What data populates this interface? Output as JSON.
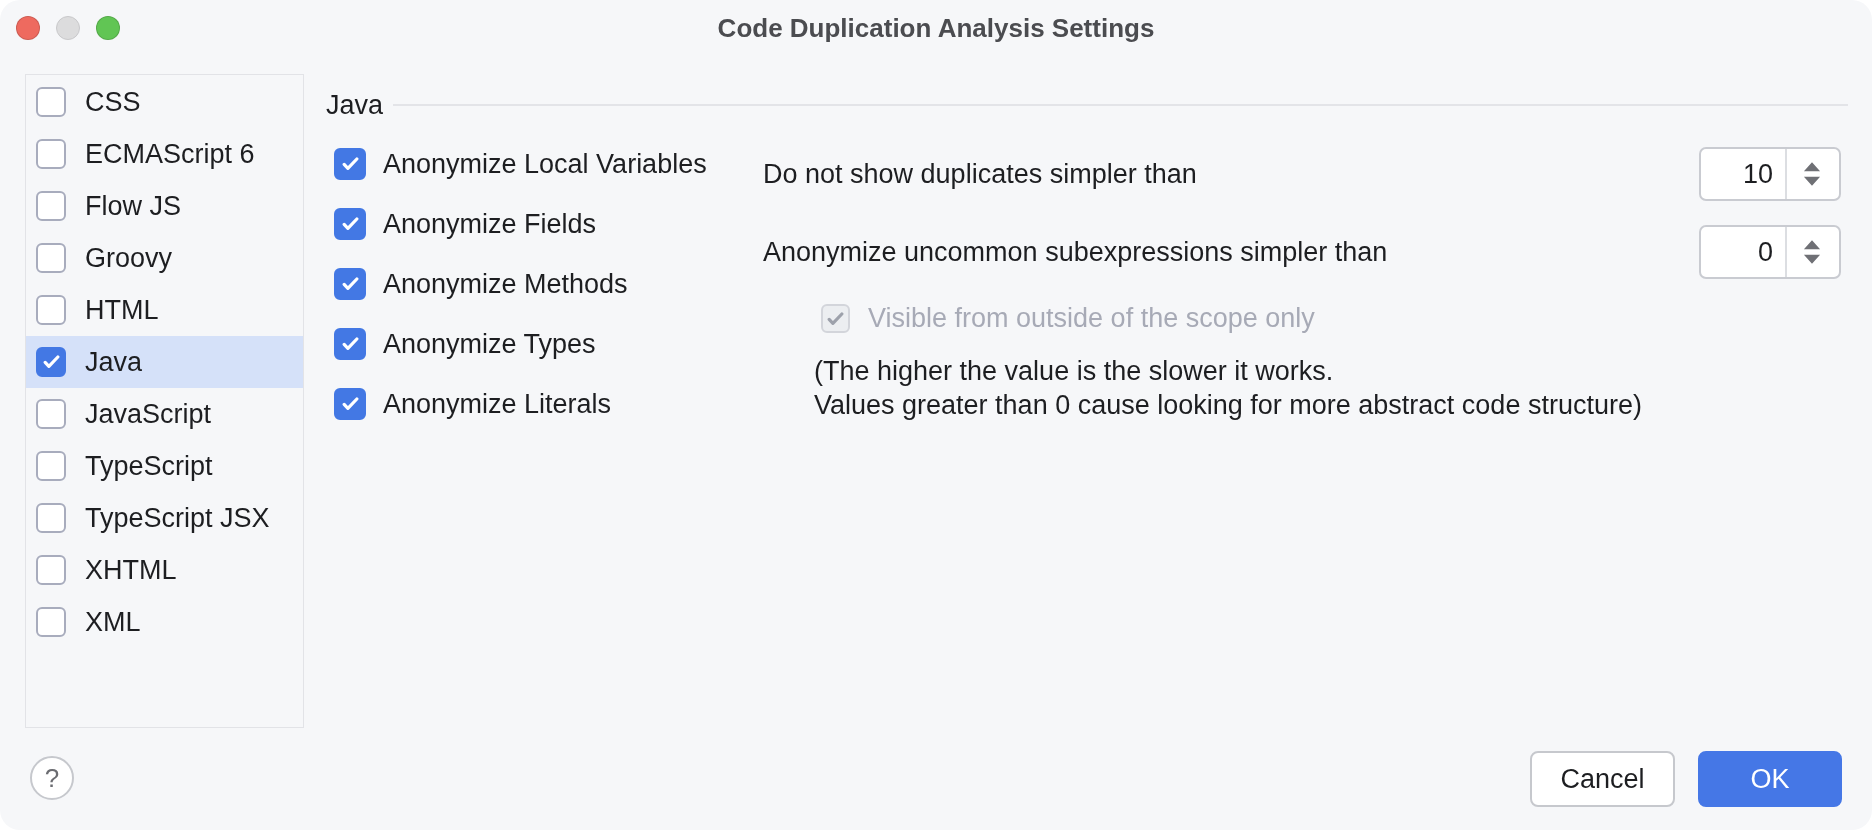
{
  "window": {
    "title": "Code Duplication Analysis Settings",
    "controls": [
      {
        "kind": "close",
        "disabled": false
      },
      {
        "kind": "minimize",
        "disabled": true
      },
      {
        "kind": "zoom",
        "disabled": false
      }
    ]
  },
  "languages": [
    {
      "label": "CSS",
      "checked": false,
      "selected": false
    },
    {
      "label": "ECMAScript 6",
      "checked": false,
      "selected": false
    },
    {
      "label": "Flow JS",
      "checked": false,
      "selected": false
    },
    {
      "label": "Groovy",
      "checked": false,
      "selected": false
    },
    {
      "label": "HTML",
      "checked": false,
      "selected": false
    },
    {
      "label": "Java",
      "checked": true,
      "selected": true
    },
    {
      "label": "JavaScript",
      "checked": false,
      "selected": false
    },
    {
      "label": "TypeScript",
      "checked": false,
      "selected": false
    },
    {
      "label": "TypeScript JSX",
      "checked": false,
      "selected": false
    },
    {
      "label": "XHTML",
      "checked": false,
      "selected": false
    },
    {
      "label": "XML",
      "checked": false,
      "selected": false
    }
  ],
  "section": {
    "title": "Java",
    "options": [
      {
        "label": "Anonymize Local Variables",
        "checked": true
      },
      {
        "label": "Anonymize Fields",
        "checked": true
      },
      {
        "label": "Anonymize Methods",
        "checked": true
      },
      {
        "label": "Anonymize Types",
        "checked": true
      },
      {
        "label": "Anonymize Literals",
        "checked": true
      }
    ]
  },
  "settings": [
    {
      "label": "Do not show duplicates simpler than",
      "value": "10"
    },
    {
      "label": "Anonymize uncommon subexpressions simpler than",
      "value": "0"
    }
  ],
  "scope_option": {
    "label": "Visible from outside of the scope only",
    "checked": true,
    "disabled": true
  },
  "hint": "(The higher the value is the slower it works.\nValues greater than 0 cause looking for more abstract code structure)",
  "help_button": {
    "label": "?"
  },
  "buttons": [
    {
      "label": "Cancel",
      "kind": "secondary"
    },
    {
      "label": "OK",
      "kind": "primary"
    }
  ]
}
